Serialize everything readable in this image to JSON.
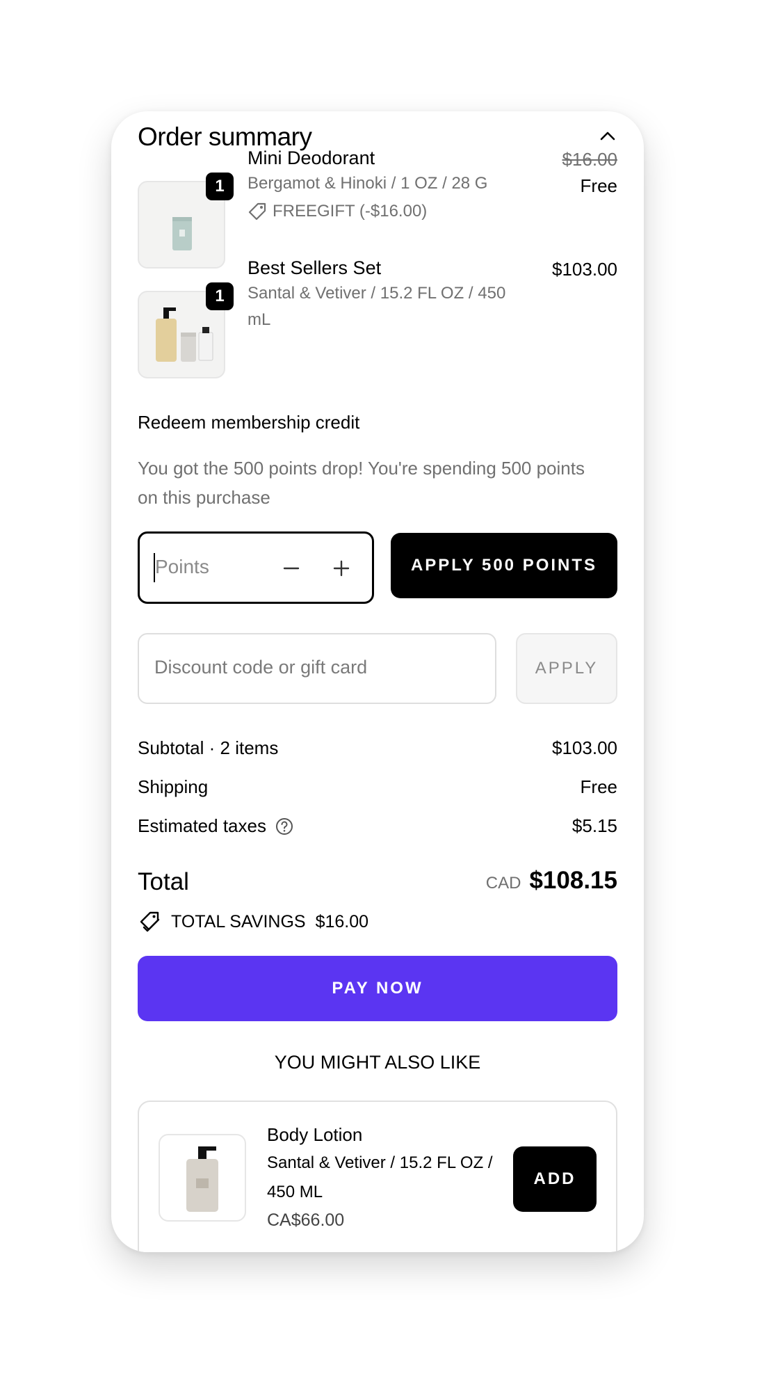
{
  "summary": {
    "title": "Order summary"
  },
  "items": [
    {
      "qty": "1",
      "name": "Mini Deodorant",
      "variant": "Bergamot & Hinoki / 1 OZ / 28 G",
      "discount": "FREEGIFT (-$16.00)",
      "original_price": "$16.00",
      "price": "Free"
    },
    {
      "qty": "1",
      "name": "Best Sellers Set",
      "variant_line1": "Santal & Vetiver / 15.2 FL OZ / 450",
      "variant_line2": "mL",
      "price": "$103.00"
    }
  ],
  "membership": {
    "heading": "Redeem membership credit",
    "note_line1": "You got the 500 points drop! You're spending 500 points",
    "note_line2": "on this purchase",
    "points_placeholder": "Points",
    "apply_label": "APPLY 500 POINTS"
  },
  "discount": {
    "placeholder": "Discount code or gift card",
    "apply_label": "APPLY"
  },
  "totals": {
    "subtotal_label": "Subtotal · 2 items",
    "subtotal_value": "$103.00",
    "shipping_label": "Shipping",
    "shipping_value": "Free",
    "taxes_label": "Estimated taxes",
    "taxes_value": "$5.15",
    "total_label": "Total",
    "currency": "CAD",
    "total_value": "$108.15",
    "savings_label": "TOTAL SAVINGS",
    "savings_value": "$16.00"
  },
  "pay": {
    "label": "PAY NOW"
  },
  "upsell": {
    "heading": "YOU MIGHT ALSO LIKE",
    "name": "Body Lotion",
    "variant_line1": "Santal & Vetiver / 15.2 FL OZ /",
    "variant_line2": "450 ML",
    "price": "CA$66.00",
    "add_label": "ADD"
  },
  "colors": {
    "accent": "#5b35f2",
    "muted_text": "#707070"
  }
}
